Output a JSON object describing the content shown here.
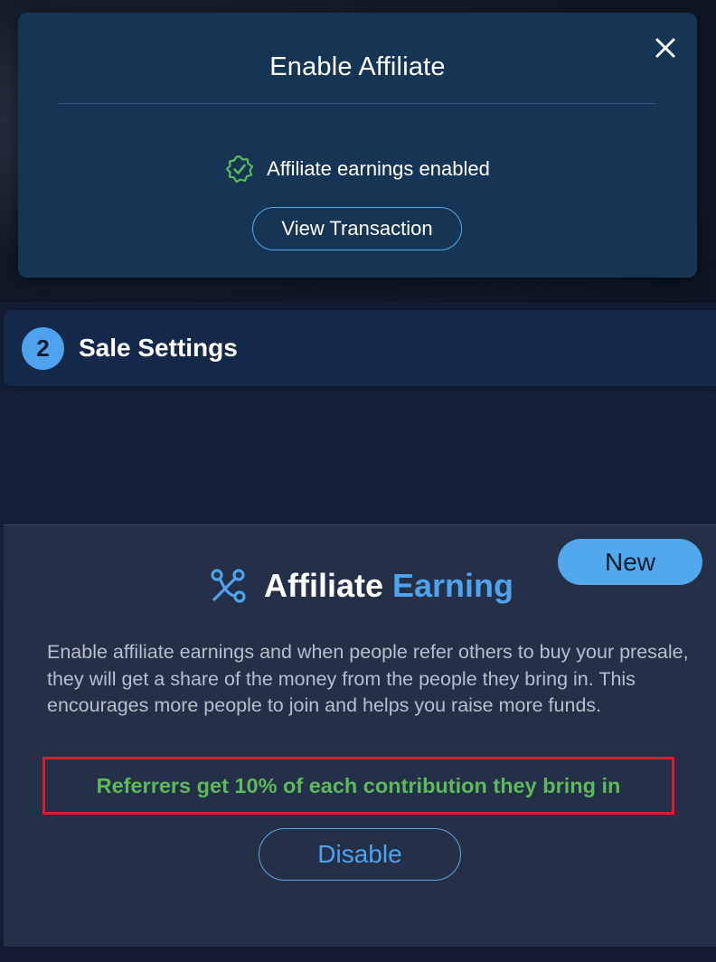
{
  "modal": {
    "title": "Enable Affiliate",
    "status_text": "Affiliate earnings enabled",
    "view_transaction_label": "View Transaction",
    "close_icon": "close-icon",
    "status_icon": "verified-check-icon"
  },
  "sale_settings": {
    "step_number": "2",
    "title": "Sale Settings"
  },
  "affiliate": {
    "badge": "New",
    "title_part1": "Affiliate",
    "title_part2": "Earning",
    "icon": "affiliate-network-icon",
    "description": "Enable affiliate earnings and when people refer others to buy your presale, they will get a share of the money from the people they bring in. This encourages more people to join and helps you raise more funds.",
    "highlight": "Referrers get 10% of each contribution they bring in",
    "disable_label": "Disable"
  },
  "colors": {
    "accent": "#4fa3ee",
    "success": "#5cba5a",
    "highlight_border": "#e21b2a",
    "modal_bg": "#163453"
  }
}
